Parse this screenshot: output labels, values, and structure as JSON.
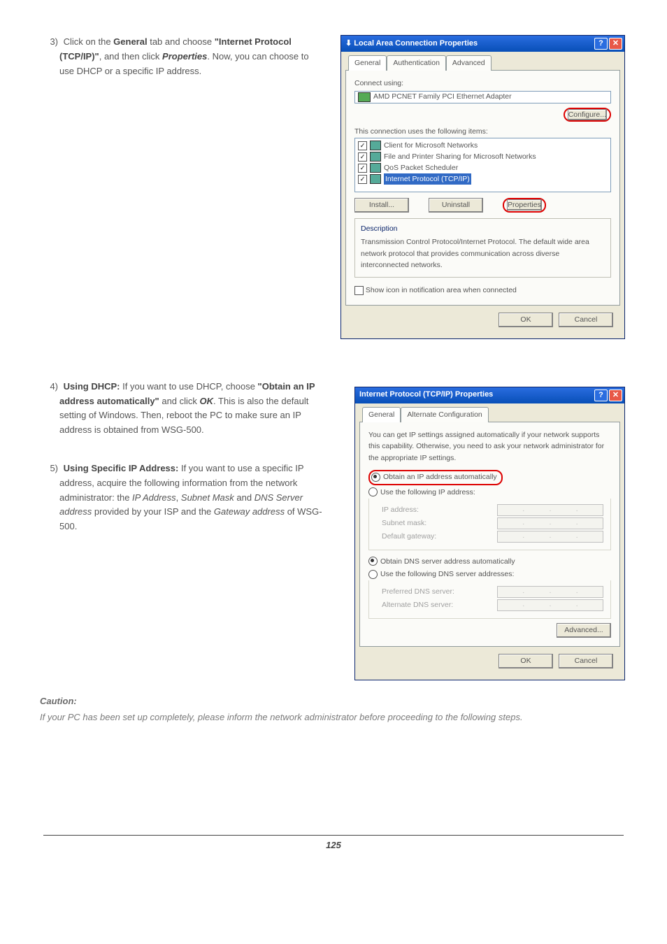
{
  "step3": {
    "num": "3)",
    "pre": "Click on the ",
    "b1": "General",
    "mid1": " tab and choose ",
    "b2": "\"Internet Protocol (TCP/IP)\"",
    "mid2": ", and then click ",
    "b3": "Properties",
    "post": ". Now, you can choose to use DHCP or a specific IP address."
  },
  "win1": {
    "title": "Local Area Connection Properties",
    "tabs": [
      "General",
      "Authentication",
      "Advanced"
    ],
    "connect_using": "Connect using:",
    "adapter": "AMD PCNET Family PCI Ethernet Adapter",
    "configure": "Configure...",
    "uses": "This connection uses the following items:",
    "items": [
      "Client for Microsoft Networks",
      "File and Printer Sharing for Microsoft Networks",
      "QoS Packet Scheduler",
      "Internet Protocol (TCP/IP)"
    ],
    "install": "Install...",
    "uninstall": "Uninstall",
    "properties": "Properties",
    "desc_head": "Description",
    "desc": "Transmission Control Protocol/Internet Protocol. The default wide area network protocol that provides communication across diverse interconnected networks.",
    "showicon": "Show icon in notification area when connected",
    "ok": "OK",
    "cancel": "Cancel"
  },
  "step4": {
    "num": "4)",
    "b1": "Using DHCP:",
    "t1": " If you want to use DHCP, choose ",
    "b2": "\"Obtain an IP address automatically\"",
    "t2": " and click ",
    "b3": "OK",
    "t3": ". This is also the default setting of Windows. Then, reboot the PC to make sure an IP address is obtained from WSG-500."
  },
  "step5": {
    "num": "5)",
    "b1": "Using Specific IP Address:",
    "t1": " If you want to use a specific IP address, acquire the following information from the network administrator: the ",
    "i1": "IP Address",
    "c1": ", ",
    "i2": "Subnet Mask",
    "c2": " and ",
    "i3": "DNS Server address",
    "t2": " provided by your ISP and the ",
    "i4": "Gateway address",
    "t3": " of WSG-500."
  },
  "win2": {
    "title": "Internet Protocol (TCP/IP) Properties",
    "tabs": [
      "General",
      "Alternate Configuration"
    ],
    "intro": "You can get IP settings assigned automatically if your network supports this capability. Otherwise, you need to ask your network administrator for the appropriate IP settings.",
    "r_auto": "Obtain an IP address automatically",
    "r_manual": "Use the following IP address:",
    "ip": "IP address:",
    "subnet": "Subnet mask:",
    "gateway": "Default gateway:",
    "dns_auto": "Obtain DNS server address automatically",
    "dns_manual": "Use the following DNS server addresses:",
    "pref": "Preferred DNS server:",
    "alt": "Alternate DNS server:",
    "advanced": "Advanced...",
    "ok": "OK",
    "cancel": "Cancel"
  },
  "caution": {
    "head": "Caution:",
    "text": "If your PC has been set up completely, please inform the network administrator before proceeding to the following steps."
  },
  "page_num": "125"
}
